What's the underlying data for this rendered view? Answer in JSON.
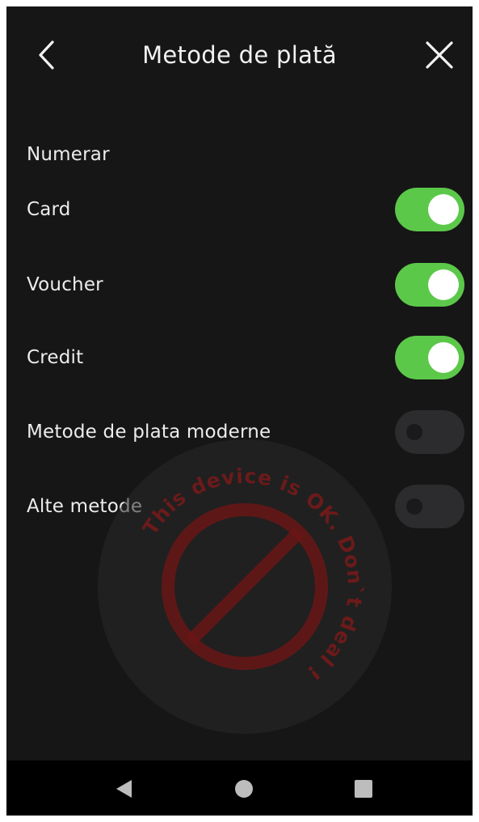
{
  "header": {
    "title": "Metode de plată",
    "back_icon": "chevron-left-icon",
    "close_icon": "close-icon"
  },
  "payment_methods": [
    {
      "label": "Numerar",
      "has_toggle": false
    },
    {
      "label": "Card",
      "has_toggle": true,
      "enabled": true
    },
    {
      "label": "Voucher",
      "has_toggle": true,
      "enabled": true
    },
    {
      "label": "Credit",
      "has_toggle": true,
      "enabled": true
    },
    {
      "label": "Metode de plata moderne",
      "has_toggle": true,
      "enabled": false
    },
    {
      "label": "Alte metode",
      "has_toggle": true,
      "enabled": false
    }
  ],
  "watermark": {
    "text": "This device is OK. Don`t deal !",
    "color": "#b01414"
  },
  "colors": {
    "background": "#161616",
    "toggle_on": "#5cc84a",
    "toggle_off": "#2c2c2e",
    "text": "#ececec"
  },
  "navbar": {
    "back_icon": "triangle-back-icon",
    "home_icon": "circle-home-icon",
    "recents_icon": "square-recents-icon"
  }
}
